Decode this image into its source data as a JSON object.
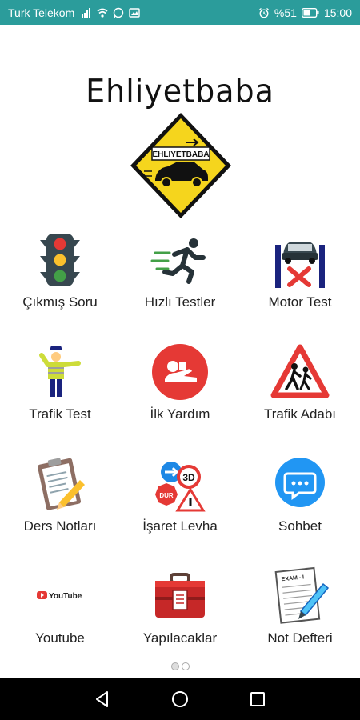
{
  "status": {
    "carrier": "Turk Telekom",
    "battery": "%51",
    "time": "15:00"
  },
  "app": {
    "title": "Ehliyetbaba",
    "logo_text": "EHLIYETBABA"
  },
  "tiles": [
    {
      "label": "Çıkmış Soru",
      "icon": "traffic-light-icon"
    },
    {
      "label": "Hızlı Testler",
      "icon": "running-man-icon"
    },
    {
      "label": "Motor Test",
      "icon": "car-lift-icon"
    },
    {
      "label": "Trafik Test",
      "icon": "traffic-police-icon"
    },
    {
      "label": "İlk Yardım",
      "icon": "first-aid-icon"
    },
    {
      "label": "Trafik Adabı",
      "icon": "pedestrian-warning-icon"
    },
    {
      "label": "Ders Notları",
      "icon": "clipboard-notes-icon"
    },
    {
      "label": "İşaret Levha",
      "icon": "road-signs-icon"
    },
    {
      "label": "Sohbet",
      "icon": "chat-bubble-icon"
    },
    {
      "label": "Youtube",
      "icon": "youtube-icon"
    },
    {
      "label": "Yapılacaklar",
      "icon": "toolbox-icon"
    },
    {
      "label": "Not Defteri",
      "icon": "notebook-pen-icon"
    }
  ],
  "youtube_logo_text": "YouTube",
  "exam_note_text": "EXAM - I",
  "road_sign_texts": {
    "dur": "DUR",
    "speed": "3D"
  },
  "colors": {
    "status_bar": "#2b9c9b",
    "logo_yellow": "#f5d51d",
    "red": "#e53935",
    "blue": "#2196f3"
  }
}
